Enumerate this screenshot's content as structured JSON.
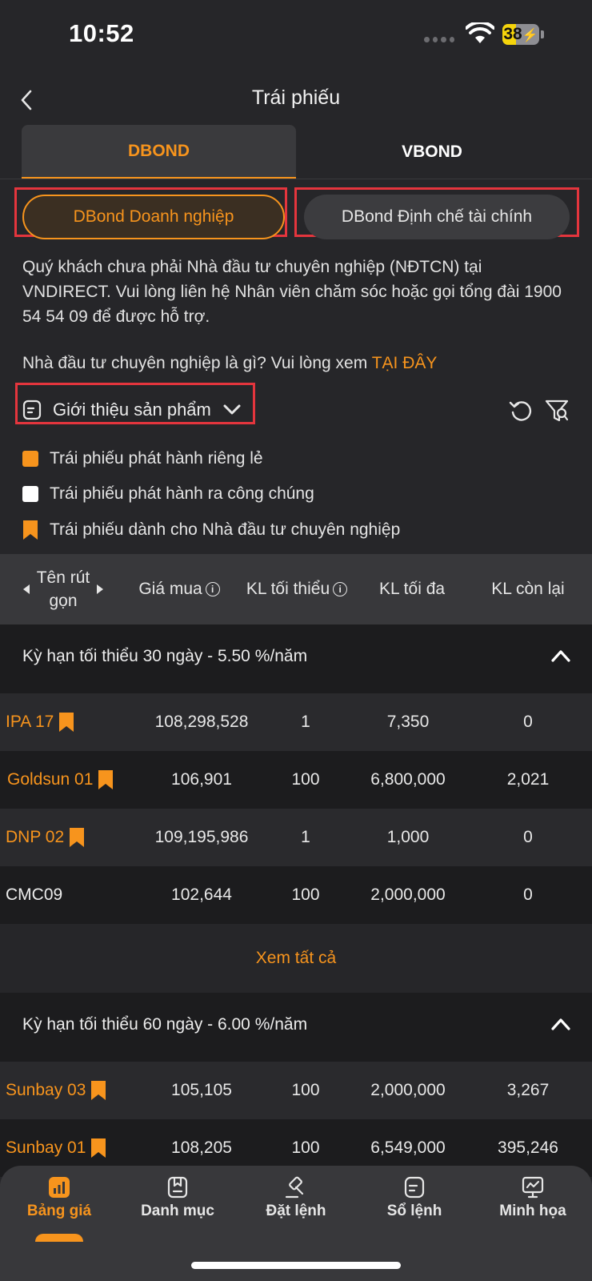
{
  "status": {
    "time": "10:52",
    "battery": "38"
  },
  "header": {
    "title": "Trái phiếu"
  },
  "tabs": [
    {
      "label": "DBOND"
    },
    {
      "label": "VBOND"
    }
  ],
  "sub_tabs": [
    {
      "label": "DBond Doanh nghiệp"
    },
    {
      "label": "DBond Định chế tài chính"
    }
  ],
  "notice": {
    "text": "Quý khách chưa phải Nhà đầu tư chuyên nghiệp (NĐTCN) tại VNDIRECT. Vui lòng liên hệ Nhân viên chăm sóc hoặc gọi tổng đài 1900 54 54 09 để được hỗ trợ.",
    "question": "Nhà đầu tư chuyên nghiệp là gì? Vui lòng xem",
    "link": "TẠI ĐÂY"
  },
  "intro": {
    "label": "Giới thiệu sản phẩm"
  },
  "legend": [
    {
      "label": "Trái phiếu phát hành riêng lẻ",
      "color": "#f7941d"
    },
    {
      "label": "Trái phiếu phát hành ra công chúng",
      "color": "#ffffff"
    },
    {
      "label": "Trái phiếu dành cho Nhà đầu tư chuyên nghiệp",
      "color": "#f7941d"
    }
  ],
  "table": {
    "headers": {
      "name_line1": "Tên rút",
      "name_line2": "gọn",
      "buy_price": "Giá mua",
      "min_qty": "KL tối thiểu",
      "max_qty": "KL tối đa",
      "remaining": "KL còn lại"
    }
  },
  "groups": [
    {
      "title": "Kỳ hạn tối thiểu 30 ngày - 5.50 %/năm",
      "rows": [
        {
          "name": "IPA 17",
          "price": "108,298,528",
          "min": "1",
          "max": "7,350",
          "remain": "0"
        },
        {
          "name": "Goldsun 01",
          "price": "106,901",
          "min": "100",
          "max": "6,800,000",
          "remain": "2,021"
        },
        {
          "name": "DNP 02",
          "price": "109,195,986",
          "min": "1",
          "max": "1,000",
          "remain": "0"
        },
        {
          "name": "CMC09",
          "price": "102,644",
          "min": "100",
          "max": "2,000,000",
          "remain": "0"
        }
      ]
    },
    {
      "title": "Kỳ hạn tối thiểu 60 ngày - 6.00 %/năm",
      "rows": [
        {
          "name": "Sunbay 03",
          "price": "105,105",
          "min": "100",
          "max": "2,000,000",
          "remain": "3,267"
        },
        {
          "name": "Sunbay 01",
          "price": "108,205",
          "min": "100",
          "max": "6,549,000",
          "remain": "395,246"
        }
      ]
    }
  ],
  "see_all": "Xem tất cả",
  "nav": [
    {
      "label": "Bảng giá",
      "icon": "chart-icon"
    },
    {
      "label": "Danh mục",
      "icon": "portfolio-icon"
    },
    {
      "label": "Đặt lệnh",
      "icon": "gavel-icon"
    },
    {
      "label": "Sổ lệnh",
      "icon": "order-book-icon"
    },
    {
      "label": "Minh họa",
      "icon": "presentation-icon"
    }
  ],
  "colors": {
    "accent": "#f7941d",
    "highlight": "#e4353d",
    "background": "#262629"
  }
}
